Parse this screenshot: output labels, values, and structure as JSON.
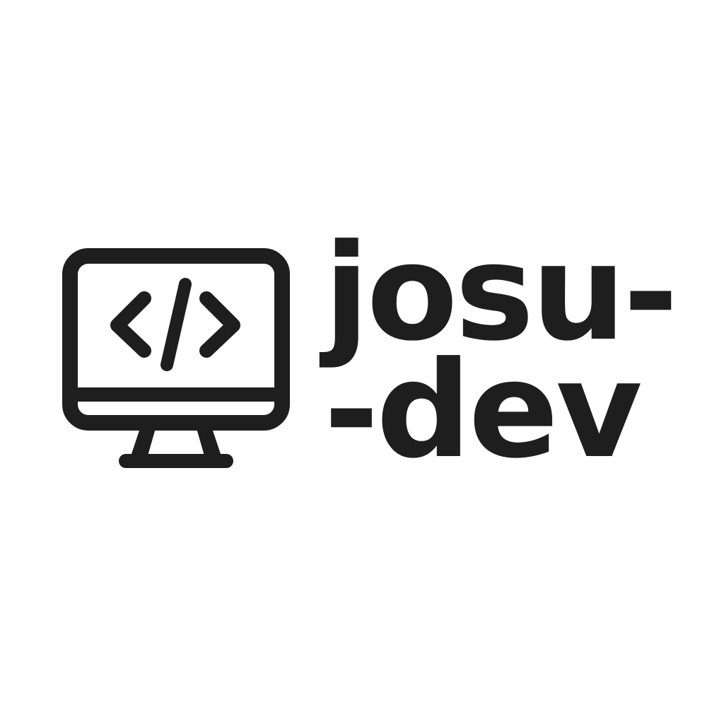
{
  "logo": {
    "icon": "monitor-code-icon",
    "wordmark_line1": "josu-",
    "wordmark_line2": "-dev",
    "ink_color": "#1e1e1e",
    "background_color": "#ffffff"
  }
}
